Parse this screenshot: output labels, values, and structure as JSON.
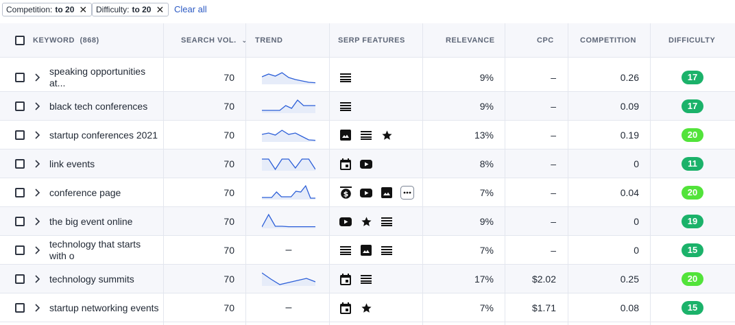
{
  "filters": {
    "chips": [
      {
        "key": "Competition:",
        "value": "to 20"
      },
      {
        "key": "Difficulty:",
        "value": "to 20"
      }
    ],
    "clear_all": "Clear all"
  },
  "header": {
    "keyword": "KEYWORD",
    "count": "(868)",
    "search_vol": "SEARCH VOL.",
    "trend": "TREND",
    "serp": "SERP FEATURES",
    "relevance": "RELEVANCE",
    "cpc": "CPC",
    "competition": "COMPETITION",
    "difficulty": "DIFFICULTY"
  },
  "colors": {
    "accent_link": "#2b59c3",
    "difficulty_dark": "#1bb26a",
    "difficulty_light": "#52e33a",
    "trend_line": "#2b5ed8",
    "trend_fill": "#e6ecf9"
  },
  "rows": [
    {
      "keyword": "speaking opportunities at...",
      "volume": "70",
      "trend": [
        0.55,
        0.75,
        0.6,
        0.85,
        0.5,
        0.35,
        0.25,
        0.15,
        0.12
      ],
      "serp": [
        "list-icon"
      ],
      "relevance": "9%",
      "cpc": "–",
      "competition": "0.26",
      "difficulty": "17",
      "diff_color": "#1bb26a"
    },
    {
      "keyword": "black tech conferences",
      "volume": "70",
      "trend": [
        0.2,
        0.2,
        0.2,
        0.2,
        0.55,
        0.35,
        0.95,
        0.55,
        0.55,
        0.55
      ],
      "serp": [
        "list-icon"
      ],
      "relevance": "9%",
      "cpc": "–",
      "competition": "0.09",
      "difficulty": "17",
      "diff_color": "#1bb26a"
    },
    {
      "keyword": "startup conferences 2021",
      "volume": "70",
      "trend": [
        0.55,
        0.65,
        0.5,
        0.85,
        0.55,
        0.65,
        0.4,
        0.15,
        0.12
      ],
      "serp": [
        "image-icon",
        "list-icon",
        "star-icon"
      ],
      "relevance": "13%",
      "cpc": "–",
      "competition": "0.19",
      "difficulty": "20",
      "diff_color": "#52e33a"
    },
    {
      "keyword": "link events",
      "volume": "70",
      "trend": [
        0.85,
        0.85,
        0.1,
        0.85,
        0.85,
        0.2,
        0.85,
        0.85,
        0.1
      ],
      "serp": [
        "calendar-icon",
        "video-icon"
      ],
      "relevance": "8%",
      "cpc": "–",
      "competition": "0",
      "difficulty": "11",
      "diff_color": "#1bb26a"
    },
    {
      "keyword": "conference page",
      "volume": "70",
      "trend": [
        0.15,
        0.15,
        0.15,
        0.55,
        0.2,
        0.2,
        0.2,
        0.6,
        0.55,
        1.0,
        0.1,
        0.1
      ],
      "serp": [
        "dollar-icon",
        "video-icon",
        "image-icon",
        "more-icon"
      ],
      "relevance": "7%",
      "cpc": "–",
      "competition": "0.04",
      "difficulty": "20",
      "diff_color": "#52e33a"
    },
    {
      "keyword": "the big event online",
      "volume": "70",
      "trend": [
        0.1,
        1.0,
        0.15,
        0.15,
        0.12,
        0.12,
        0.12,
        0.12,
        0.12
      ],
      "serp": [
        "video-icon",
        "star-icon",
        "list-icon"
      ],
      "relevance": "9%",
      "cpc": "–",
      "competition": "0",
      "difficulty": "19",
      "diff_color": "#1bb26a"
    },
    {
      "keyword": "technology that starts with o",
      "volume": "70",
      "trend": null,
      "trend_text": "–",
      "serp": [
        "list-icon",
        "image-icon",
        "list-icon"
      ],
      "relevance": "7%",
      "cpc": "–",
      "competition": "0",
      "difficulty": "15",
      "diff_color": "#1bb26a"
    },
    {
      "keyword": "technology summits",
      "volume": "70",
      "trend": [
        0.95,
        0.5,
        0.1,
        0.25,
        0.4,
        0.55,
        0.3
      ],
      "serp": [
        "calendar-icon",
        "list-icon"
      ],
      "relevance": "17%",
      "cpc": "$2.02",
      "competition": "0.25",
      "difficulty": "20",
      "diff_color": "#52e33a"
    },
    {
      "keyword": "startup networking events",
      "volume": "70",
      "trend": null,
      "trend_text": "–",
      "serp": [
        "calendar-icon",
        "star-icon"
      ],
      "relevance": "7%",
      "cpc": "$1.71",
      "competition": "0.08",
      "difficulty": "15",
      "diff_color": "#1bb26a"
    }
  ]
}
